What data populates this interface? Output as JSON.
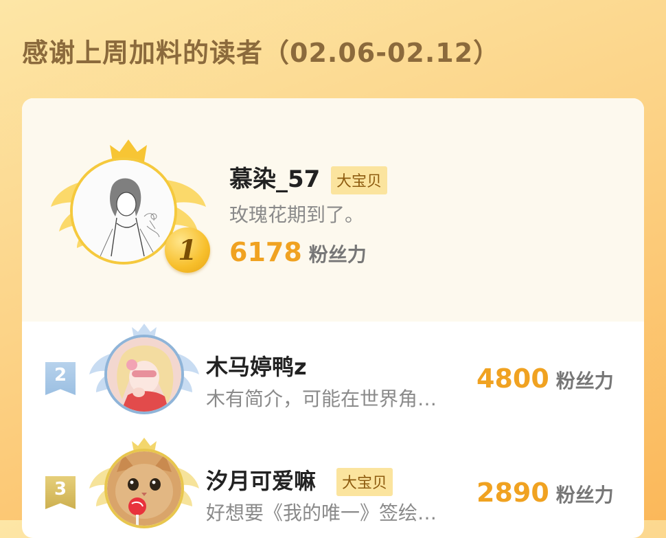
{
  "header": {
    "title": "感谢上周加料的读者（02.06-02.12）"
  },
  "colors": {
    "accent": "#f0a221",
    "badge_bg": "#fbe49e",
    "gold": "#f7bf2c",
    "silver": "#a9c8e6",
    "bronze": "#d8b64a"
  },
  "leaderboard": {
    "first": {
      "rank": "1",
      "name": "慕染_57",
      "badge": "大宝贝",
      "bio": "玫瑰花期到了。",
      "score": "6178",
      "unit": "粉丝力",
      "avatar_icon": "sketch-girl-avatar"
    },
    "rows": [
      {
        "rank": "2",
        "name": "木马婷鸭z",
        "badge": "",
        "bio": "木有简介，可能在世界角…",
        "score": "4800",
        "unit": "粉丝力",
        "avatar_icon": "anime-girl-avatar"
      },
      {
        "rank": "3",
        "name": "汐月可爱嘛",
        "badge": "大宝贝",
        "bio": "好想要《我的唯一》签绘…",
        "score": "2890",
        "unit": "粉丝力",
        "avatar_icon": "cat-lollipop-avatar"
      }
    ]
  }
}
